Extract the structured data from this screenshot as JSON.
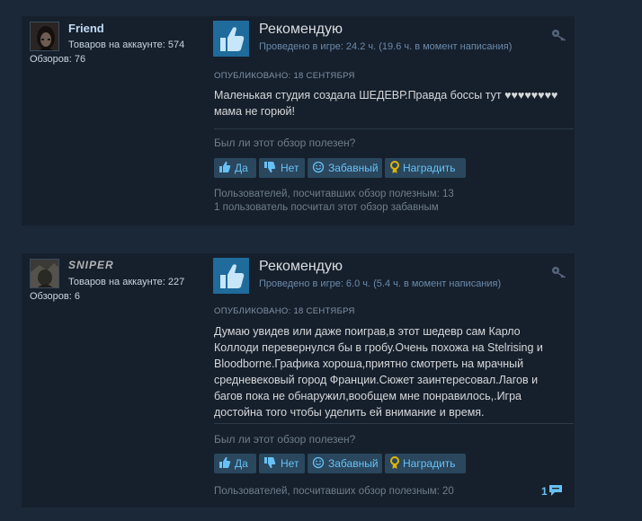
{
  "colors": {
    "page_bg": "#1b2838",
    "card_bg": "#16202d",
    "thumb_bg": "#1f6b9c",
    "button_bg": "#2a475e",
    "button_text": "#67c1f5",
    "award_icon": "#e4b400"
  },
  "reviews": [
    {
      "author": "Friend",
      "products": "Товаров на аккаунте: 574",
      "reviews_count": "Обзоров: 76",
      "verdict": "Рекомендую",
      "hours": "Проведено в игре: 24.2 ч. (19.6 ч. в момент написания)",
      "posted": "ОПУБЛИКОВАНО: 18 СЕНТЯБРЯ",
      "body": "Маленькая студия создала ШЕДЕВР.Правда боссы тут ♥♥♥♥♥♥♥♥ мама не горюй!",
      "question": "Был ли этот обзор полезен?",
      "buttons": {
        "yes": "Да",
        "no": "Нет",
        "funny": "Забавный",
        "award": "Наградить"
      },
      "helpful_stat": "Пользователей, посчитавших обзор полезным: 13",
      "funny_stat": "1 пользователь посчитал этот обзор забавным",
      "avatar_icon": "user-avatar",
      "key_icon": "key-icon"
    },
    {
      "author": "SNIPER",
      "products": "Товаров на аккаунте: 227",
      "reviews_count": "Обзоров: 6",
      "verdict": "Рекомендую",
      "hours": "Проведено в игре: 6.0 ч. (5.4 ч. в момент написания)",
      "posted": "ОПУБЛИКОВАНО: 18 СЕНТЯБРЯ",
      "body": "Думаю увидев или даже поиграв,в этот шедевр сам Карло Коллоди перевернулся бы в гробу.Очень похожа на Stelrising и Bloodborne.Графика хороша,приятно смотреть на мрачный средневековый город Франции.Сюжет заинтересовал.Лагов и багов пока не обнаружил,вообщем мне понравилось,.Игра достойна того чтобы уделить ей внимание и время.",
      "question": "Был ли этот обзор полезен?",
      "buttons": {
        "yes": "Да",
        "no": "Нет",
        "funny": "Забавный",
        "award": "Наградить"
      },
      "helpful_stat": "Пользователей, посчитавших обзор полезным: 20",
      "comments_count": "1",
      "avatar_icon": "user-avatar",
      "key_icon": "key-icon"
    }
  ]
}
